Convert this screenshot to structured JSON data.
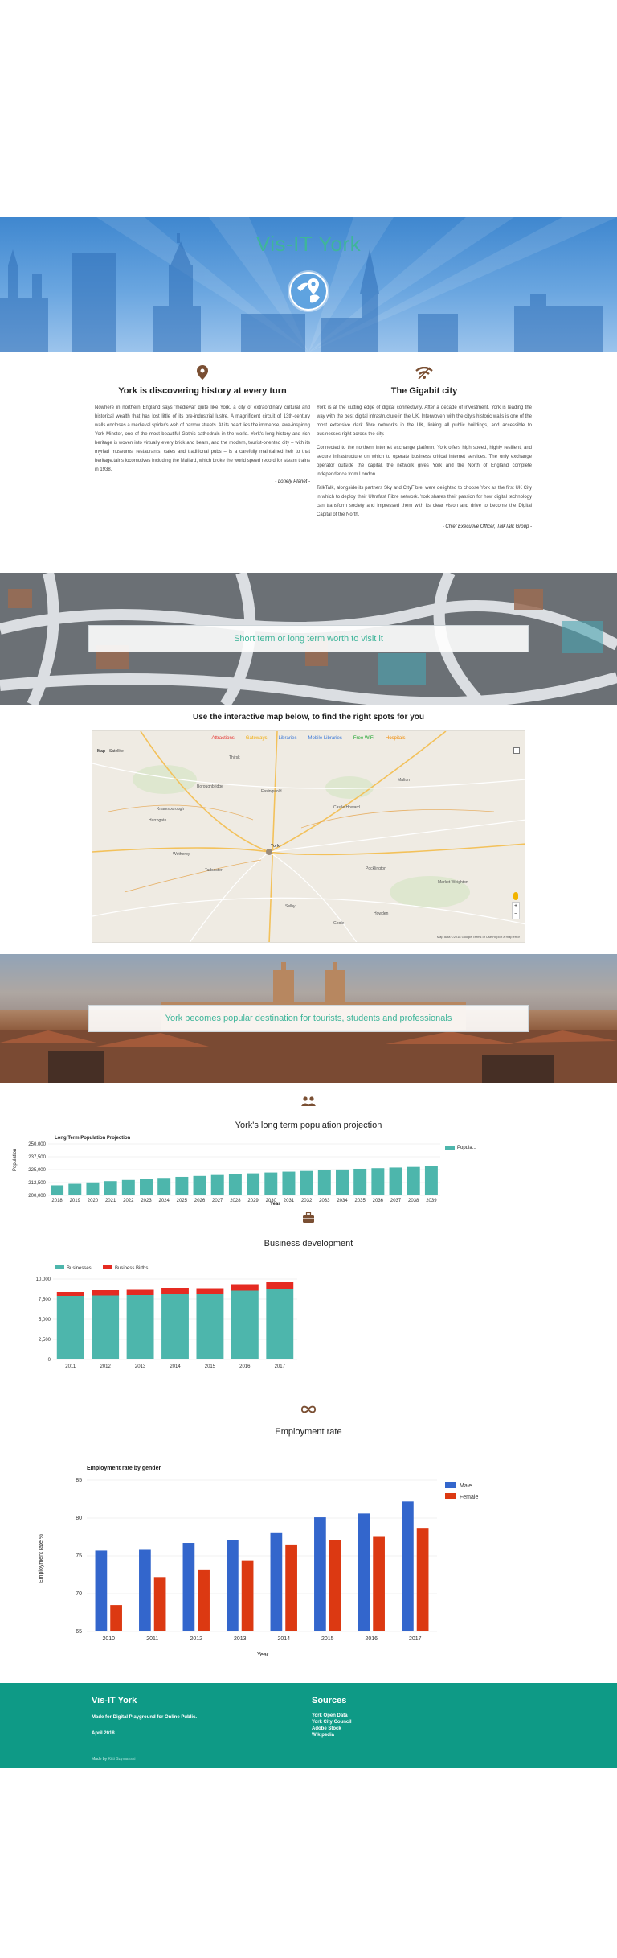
{
  "hero": {
    "title": "Vis-IT York"
  },
  "left_column": {
    "heading": "York is discovering history at every turn",
    "body": "Nowhere in northern England says 'medieval' quite like York, a city of extraordinary cultural and historical wealth that has lost little of its pre-industrial lustre. A magnificent circuit of 13th-century walls encloses a medieval spider's web of narrow streets. At its heart lies the immense, awe-inspiring York Minster, one of the most beautiful Gothic cathedrals in the world. York's long history and rich heritage is woven into virtually every brick and beam, and the modern, tourist-oriented city – with its myriad museums, restaurants, cafes and traditional pubs – is a carefully maintained heir to that heritage.tains locomotives including the Mallard, which broke the world speed record for steam trains in 1938.",
    "quote": "- Lonely Planet -"
  },
  "right_column": {
    "heading": "The Gigabit city",
    "paragraphs": [
      "York is at the cutting edge of digital connectivity. After a decade of investment, York is leading the way with the best digital infrastructure in the UK. Interwoven with the city's historic walls is one of the most extensive dark fibre networks in the UK, linking all public buildings, and accessible to businesses right across the city.",
      "Connected to the northern internet exchange platform, York offers high speed, highly resilient, and secure infrastructure on which to operate business critical internet services. The only exchange operator outside the capital, the network gives York and the North of England complete independence from London.",
      "TalkTalk, alongside its partners Sky and CityFibre, were delighted to choose York as the first UK City in which to deploy their Ultrafast Fibre network. York shares their passion for how digital technology can transform society and impressed them with its clear vision and drive to become the Digital Capital of the North."
    ],
    "quote": "- Chief Executive Officer, TalkTalk Group -"
  },
  "banner1": "Short term or long term worth to visit it",
  "map": {
    "title": "Use the interactive map below, to find the right spots for you",
    "filters": [
      {
        "label": "Attractions",
        "color": "#e53935"
      },
      {
        "label": "Gateways",
        "color": "#f2a900"
      },
      {
        "label": "Libraries",
        "color": "#3a78d8"
      },
      {
        "label": "Mobile Libraries",
        "color": "#3a78d8"
      },
      {
        "label": "Free WiFi",
        "color": "#1aa32b"
      },
      {
        "label": "Hospitals",
        "color": "#f08a00"
      }
    ],
    "mode_map": "Map",
    "mode_sat": "Satellite",
    "credit": "Map data ©2018 Google   Terms of Use   Report a map error",
    "places": [
      "York",
      "Harrogate",
      "Knaresborough",
      "Selby",
      "Tadcaster",
      "Malton",
      "Pocklington",
      "Market Weighton",
      "Easingwold",
      "Thirsk",
      "Wetherby",
      "Goole",
      "Howden",
      "Boroughbridge",
      "Castle Howard"
    ]
  },
  "banner2": "York becomes popular destination for tourists, students and professionals",
  "population": {
    "title": "York's long term population projection",
    "chart_title": "Long Term Population Projection",
    "legend": "Popula...",
    "xlabel": "Year",
    "ylabel": "Population"
  },
  "business": {
    "title": "Business development"
  },
  "employment": {
    "title": "Employment rate",
    "chart_title": "Employment rate by gender",
    "xlabel": "Year",
    "ylabel": "Employment rate %"
  },
  "footer": {
    "brand": "Vis-IT York",
    "made_for": "Made for Digital Playground for Online Public.",
    "date": "April 2018",
    "sources_title": "Sources",
    "sources": [
      "York Open Data",
      "York City Council",
      "Adobe Stock",
      "Wikipedia"
    ],
    "made_by": "Made by",
    "author": "Kitti Szymanski"
  },
  "chart_data": [
    {
      "type": "bar",
      "title": "Long Term Population Projection",
      "xlabel": "Year",
      "ylabel": "Population",
      "categories": [
        "2018",
        "2019",
        "2020",
        "2021",
        "2022",
        "2023",
        "2024",
        "2025",
        "2026",
        "2027",
        "2028",
        "2029",
        "2030",
        "2031",
        "2032",
        "2033",
        "2034",
        "2035",
        "2036",
        "2037",
        "2038",
        "2039"
      ],
      "series": [
        {
          "name": "Popula...",
          "color": "#4db6ac",
          "values": [
            209800,
            211300,
            212700,
            213900,
            215000,
            216000,
            217000,
            218000,
            218900,
            219800,
            220600,
            221400,
            222200,
            223000,
            223700,
            224400,
            225100,
            225800,
            226400,
            227000,
            227600,
            228200
          ]
        }
      ],
      "ylim": [
        200000,
        250000
      ],
      "yticks": [
        200000,
        212500,
        225000,
        237500,
        250000
      ],
      "legend": "right"
    },
    {
      "type": "bar",
      "stacked": true,
      "categories": [
        "2011",
        "2012",
        "2013",
        "2014",
        "2015",
        "2016",
        "2017"
      ],
      "series": [
        {
          "name": "Businesses",
          "color": "#4db6ac",
          "values": [
            7900,
            7950,
            8000,
            8150,
            8150,
            8550,
            8800
          ]
        },
        {
          "name": "Business Births",
          "color": "#e52b22",
          "values": [
            500,
            650,
            750,
            750,
            700,
            800,
            800
          ]
        }
      ],
      "ylim": [
        0,
        10000
      ],
      "yticks": [
        0,
        2500,
        5000,
        7500,
        10000
      ],
      "legend": "top"
    },
    {
      "type": "bar",
      "title": "Employment rate by gender",
      "xlabel": "Year",
      "ylabel": "Employment rate %",
      "categories": [
        "2010",
        "2011",
        "2012",
        "2013",
        "2014",
        "2015",
        "2016",
        "2017"
      ],
      "series": [
        {
          "name": "Male",
          "color": "#3366cc",
          "values": [
            75.7,
            75.8,
            76.7,
            77.1,
            78.0,
            80.1,
            80.6,
            82.2
          ]
        },
        {
          "name": "Female",
          "color": "#dc3912",
          "values": [
            68.5,
            72.2,
            73.1,
            74.4,
            76.5,
            77.1,
            77.5,
            78.6
          ]
        }
      ],
      "ylim": [
        65,
        85
      ],
      "yticks": [
        65,
        70,
        75,
        80,
        85
      ],
      "legend": "right"
    }
  ]
}
